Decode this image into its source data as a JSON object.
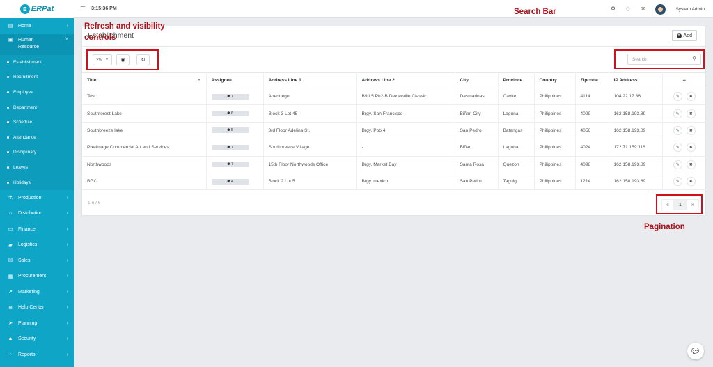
{
  "app": {
    "logo_text": "ERPat",
    "logo_mark": "E"
  },
  "topbar": {
    "time": "3:15:36 PM",
    "user_name": "System Admin"
  },
  "sidebar": {
    "items": [
      {
        "label": "Home",
        "icon": "home-icon"
      },
      {
        "label": "Human Resource",
        "icon": "briefcase-icon"
      },
      {
        "label": "Production",
        "icon": "flask-icon"
      },
      {
        "label": "Distribution",
        "icon": "bank-icon"
      },
      {
        "label": "Finance",
        "icon": "money-icon"
      },
      {
        "label": "Logistics",
        "icon": "truck-icon"
      },
      {
        "label": "Sales",
        "icon": "cart-icon"
      },
      {
        "label": "Procurement",
        "icon": "basket-icon"
      },
      {
        "label": "Marketing",
        "icon": "chart-line-icon"
      },
      {
        "label": "Help Center",
        "icon": "lifebuoy-icon"
      },
      {
        "label": "Planning",
        "icon": "paper-plane-icon"
      },
      {
        "label": "Security",
        "icon": "lock-icon"
      },
      {
        "label": "Reports",
        "icon": "pie-chart-icon"
      }
    ],
    "sub_items": [
      "Establishment",
      "Recruitment",
      "Employee",
      "Department",
      "Schedule",
      "Attendance",
      "Disciplinary",
      "Leaves",
      "Holidays"
    ]
  },
  "card": {
    "title": "Establishment",
    "add_label": "Add",
    "page_size": "25",
    "search_placeholder": "Search",
    "columns": [
      "Title",
      "Assignee",
      "Address Line 1",
      "Address Line 2",
      "City",
      "Province",
      "Country",
      "Zipcode",
      "IP Address"
    ],
    "rows": [
      [
        "Test",
        "1",
        "Abednego",
        "B9 L5 Ph2-B Dexterville Classic",
        "Dasmarinas",
        "Cavite",
        "Philippines",
        "4114",
        "104.22.17.86"
      ],
      [
        "Southforest Lake",
        "6",
        "Block 3 Lot 45",
        "Brgy. San Francisco",
        "Biñan City",
        "Laguna",
        "Philippines",
        "4099",
        "162.158.193.89"
      ],
      [
        "Southbreeze lake",
        "5",
        "3rd Floor Adelina St.",
        "Brgy. Pob 4",
        "San Pedro",
        "Batangas",
        "Philippines",
        "4056",
        "162.158.193.89"
      ],
      [
        "Pixelmage Commercial Art and Services",
        "1",
        "Southbreeze Village",
        "-",
        "Biñan",
        "Laguna",
        "Philippines",
        "4024",
        "172.71.159.116"
      ],
      [
        "Northwoods",
        "7",
        "15th Floor Northwoods Office",
        "Brgy. Market Bay",
        "Santa Rosa",
        "Quezon",
        "Philippines",
        "4098",
        "162.158.193.89"
      ],
      [
        "BGC",
        "4",
        "Block 2 Lot 5",
        "Brgy. mexico",
        "San Pedro",
        "Taguig",
        "Philippines",
        "1214",
        "162.158.193.89"
      ]
    ],
    "pagination": {
      "info": "1-6 / 6",
      "prev": "«",
      "page": "1",
      "next": "»"
    }
  },
  "annotations": {
    "controls": "Refresh and visibility controls",
    "search": "Search Bar",
    "pagination": "Pagination"
  },
  "colors": {
    "sidebar": "#0ea5c6",
    "annotation": "#b0101a",
    "highlight_box": "#d0111b"
  }
}
